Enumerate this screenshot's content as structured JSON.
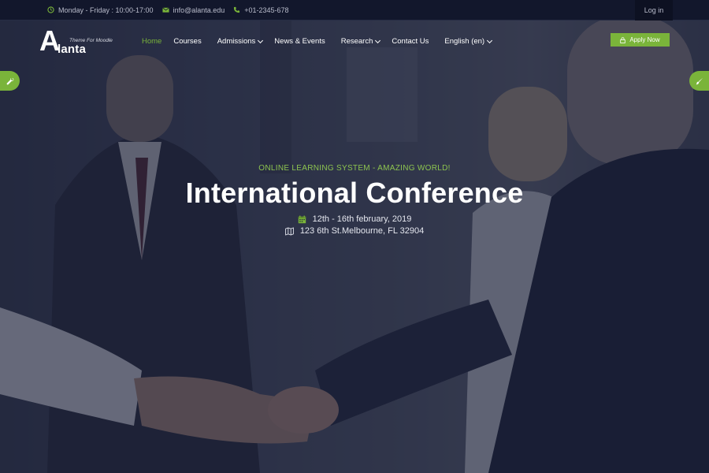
{
  "topbar": {
    "hours": "Monday - Friday : 10:00-17:00",
    "email": "info@alanta.edu",
    "phone": "+01-2345-678",
    "login_label": "Log in",
    "icons": [
      "clock-icon",
      "envelope-icon",
      "phone-icon"
    ]
  },
  "logo": {
    "letter": "A",
    "name": "lanta",
    "tagline": "Theme For Moodle"
  },
  "nav": {
    "items": [
      {
        "label": "Home",
        "active": true,
        "has_dropdown": false
      },
      {
        "label": "Courses",
        "active": false,
        "has_dropdown": false
      },
      {
        "label": "Admissions",
        "active": false,
        "has_dropdown": true
      },
      {
        "label": "News & Events",
        "active": false,
        "has_dropdown": false
      },
      {
        "label": "Research",
        "active": false,
        "has_dropdown": true
      },
      {
        "label": "Contact Us",
        "active": false,
        "has_dropdown": false
      },
      {
        "label": "English (en)",
        "active": false,
        "has_dropdown": true
      }
    ]
  },
  "apply_button": {
    "label": "Apply Now",
    "icon": "lock-icon"
  },
  "side_tabs": {
    "left_icon": "wrench-icon",
    "right_icon": "brush-icon"
  },
  "hero": {
    "subtitle": "ONLINE LEARNING SYSTEM - AMAZING WORLD!",
    "title": "International Conference",
    "date": "12th - 16th february, 2019",
    "location": "123 6th St.Melbourne, FL 32904",
    "date_icon": "calendar-icon",
    "location_icon": "map-icon"
  },
  "colors": {
    "accent": "#7ab43a",
    "topbar_bg": "#12172c",
    "overlay": "#161b34"
  }
}
